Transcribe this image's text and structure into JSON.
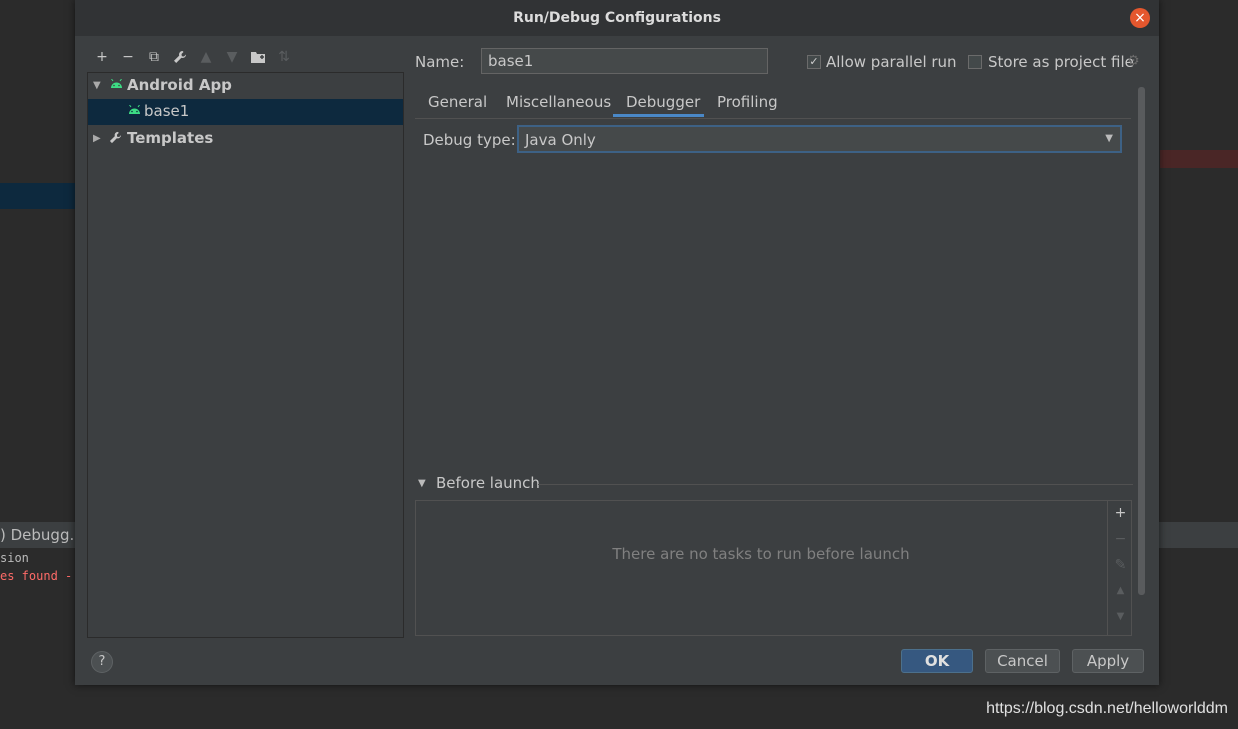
{
  "background": {
    "toolwindow_title": ") Debugg...",
    "console_line1": "sion",
    "console_line2": "es found -",
    "watermark": "https://blog.csdn.net/helloworlddm"
  },
  "dialog": {
    "title": "Run/Debug Configurations",
    "close_icon": "×"
  },
  "toolbar": {
    "add": "+",
    "remove": "−",
    "copy": "⧉",
    "edit_defaults": "🔧",
    "move_up": "▲",
    "move_down": "▼",
    "new_folder": "▣",
    "sort": "⇅"
  },
  "tree": {
    "items": [
      {
        "label": "Android App",
        "icon": "android-icon",
        "expanded": true
      },
      {
        "label": "base1",
        "icon": "android-icon",
        "selected": true
      },
      {
        "label": "Templates",
        "icon": "wrench-icon",
        "expanded": false
      }
    ]
  },
  "config": {
    "name_label": "Name:",
    "name_value": "base1",
    "allow_parallel_label": "Allow parallel run",
    "allow_parallel_checked": "✓",
    "store_project_label": "Store as project file"
  },
  "tabs": [
    "General",
    "Miscellaneous",
    "Debugger",
    "Profiling"
  ],
  "active_tab": "Debugger",
  "debugger": {
    "debug_type_label": "Debug type:",
    "debug_type_value": "Java Only"
  },
  "before_launch": {
    "title": "Before launch",
    "empty_text": "There are no tasks to run before launch"
  },
  "buttons": {
    "help": "?",
    "ok": "OK",
    "cancel": "Cancel",
    "apply": "Apply"
  },
  "colors": {
    "accent": "#4a88c7",
    "ok_button": "#365880",
    "close_button": "#e4572e",
    "android_green": "#3ddc84"
  }
}
